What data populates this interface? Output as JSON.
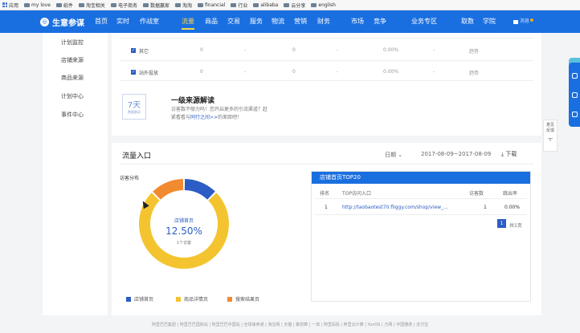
{
  "bookmarks": [
    "应用",
    "my love",
    "纸件",
    "淘宝相关",
    "电子商务",
    "数据赢家",
    "淘淘",
    "financial",
    "行业",
    "alibaba",
    "云分享",
    "english"
  ],
  "nav": {
    "brand": "生意参谋",
    "items": [
      "首页",
      "实时",
      "作战室",
      "流量",
      "商品",
      "交易",
      "服务",
      "物流",
      "营销",
      "财务",
      "市场",
      "竞争",
      "业务专区",
      "取数",
      "学院"
    ],
    "active": "流量",
    "msg": "消息"
  },
  "sidebar": {
    "items": [
      "计划监控",
      "店铺来源",
      "商品来源",
      "计划中心",
      "事件中心"
    ]
  },
  "top_rows": [
    {
      "name": "其它",
      "c1": "0",
      "c2": "-",
      "c3": "0",
      "c4": "-",
      "c5": "0.00%",
      "c6": "-",
      "trend": "趋势"
    },
    {
      "name": "站外投放",
      "c1": "0",
      "c2": "-",
      "c3": "0",
      "c4": "-",
      "c5": "0.00%",
      "c6": "-",
      "trend": "趋势"
    }
  ],
  "promo": {
    "days": "7天",
    "tag": "数据解读",
    "title": "一级来源解读",
    "line1": "访客数不够力吗！您开启更多的引流渠道？赶",
    "line2": "紧看看与",
    "link": "同行之间>>",
    "line3": "的差距吧！"
  },
  "flow": {
    "title": "流量入口",
    "date_label": "日期",
    "range": "2017-08-09~2017-08-09",
    "download": "下载",
    "dist_label": "访客分布"
  },
  "chart_data": {
    "type": "pie",
    "categories": [
      "店铺首页",
      "商品详情页",
      "搜索结果页"
    ],
    "values": [
      12.5,
      75,
      12.5
    ],
    "colors": [
      "#2b5dc4",
      "#f4c430",
      "#f28a30"
    ],
    "center_label": "店铺首页",
    "center_value": "12.50%",
    "center_count": "1个访客"
  },
  "top20": {
    "title": "店铺首页TOP20",
    "headers": [
      "排名",
      "TOP访问入口",
      "访客数",
      "跳出率"
    ],
    "rows": [
      {
        "rank": "1",
        "url": "http://taobaotest70.fliggy.com/shop/view_...",
        "visitors": "1",
        "bounce": "0.00%"
      }
    ],
    "page": "1",
    "total": "共1页"
  },
  "footer": "阿里巴巴集团 | 阿里巴巴国际站 | 阿里巴巴中国站 | 全球速卖通 | 淘宝网 | 天猫 | 聚划算 | 一淘 | 阿里妈妈 | 阿里云计算 | YunOS | 万网 | 中国雅虎 | 支付宝",
  "right_float": {
    "feedback1": "意见",
    "feedback2": "反馈",
    "top": "ㅜ"
  }
}
